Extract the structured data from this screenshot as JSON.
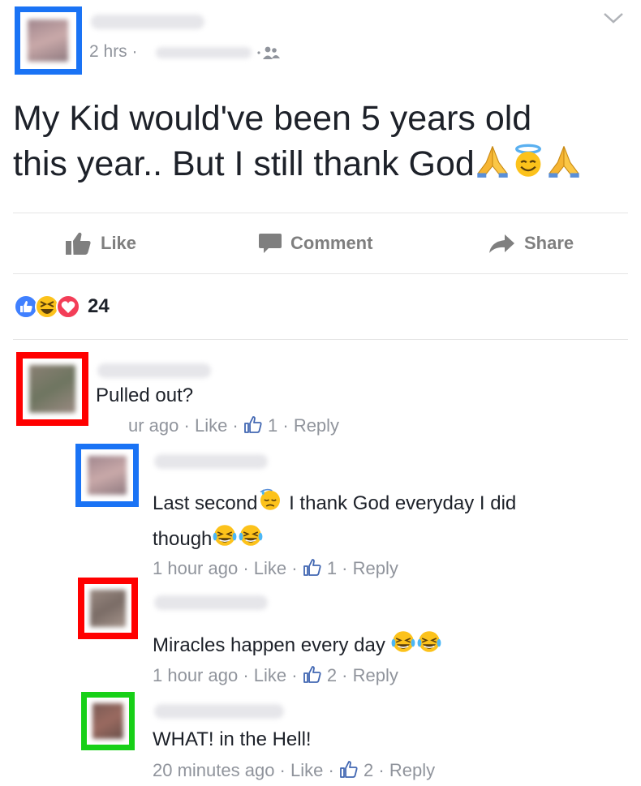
{
  "post": {
    "time": "2 hrs",
    "separator": "·",
    "text_line1": "My Kid would've been 5 years old",
    "text_line2": "this year.. But I still thank God",
    "emojis": [
      "folded-hands-icon",
      "smiling-face-with-halo-icon",
      "folded-hands-icon"
    ]
  },
  "actions": {
    "like": "Like",
    "comment": "Comment",
    "share": "Share"
  },
  "reactions": {
    "count": "24",
    "types": [
      "like",
      "haha",
      "love"
    ]
  },
  "comments": [
    {
      "text": "Pulled out?",
      "meta_time": "ur ago",
      "meta_like": "Like",
      "meta_likes": "1",
      "meta_reply": "Reply",
      "frame_color": "#ff0000"
    },
    {
      "text_line1": "Last second",
      "text_line1b": " I thank God everyday I did",
      "text_line2": "though",
      "meta_time": "1 hour ago",
      "meta_like": "Like",
      "meta_likes": "1",
      "meta_reply": "Reply",
      "frame_color": "#1a73f5"
    },
    {
      "text": "Miracles happen every day ",
      "meta_time": "1 hour ago",
      "meta_like": "Like",
      "meta_likes": "2",
      "meta_reply": "Reply",
      "frame_color": "#ff0000"
    },
    {
      "text": "WHAT! in the Hell!",
      "meta_time": "20 minutes ago",
      "meta_like": "Like",
      "meta_likes": "2",
      "meta_reply": "Reply",
      "frame_color": "#17d017"
    }
  ],
  "colors": {
    "post_frame": "#1a73f5",
    "meta_gray": "#90949c",
    "action_gray": "#7f7f7f",
    "like_blue": "#4080ff"
  }
}
